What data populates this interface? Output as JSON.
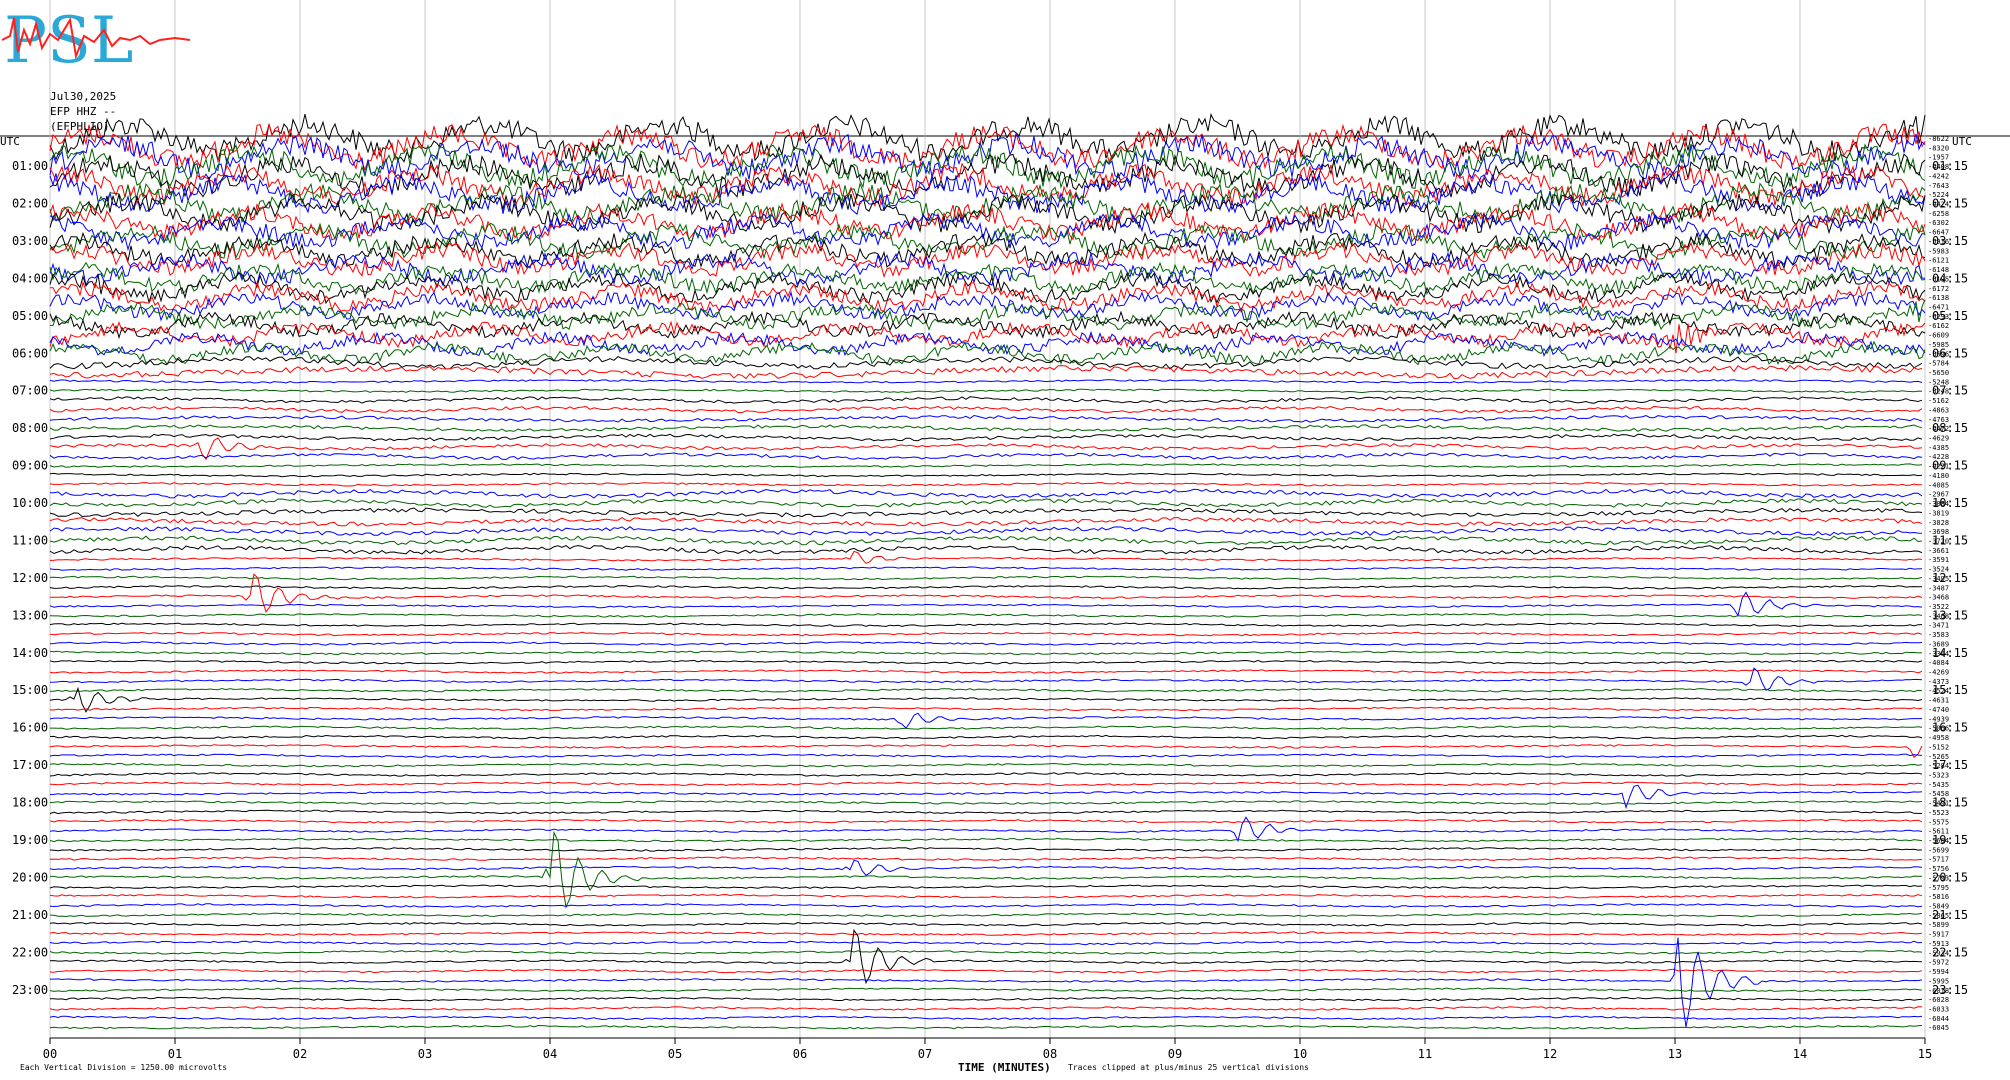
{
  "logo_text": "PSL",
  "header": {
    "date": "Jul30,2025",
    "channel": "EFP HHZ --",
    "network": "(EFPHLIO)"
  },
  "utc_label_left": "UTC",
  "utc_label_right": "UTC",
  "chart_data": {
    "type": "line",
    "title": "",
    "xlabel": "TIME (MINUTES)",
    "x_ticks": [
      "00",
      "01",
      "02",
      "03",
      "04",
      "05",
      "06",
      "07",
      "08",
      "09",
      "10",
      "11",
      "12",
      "13",
      "14",
      "15"
    ],
    "xlim": [
      0,
      15
    ],
    "left_hour_labels": [
      "01:00",
      "02:00",
      "03:00",
      "04:00",
      "05:00",
      "06:00",
      "07:00",
      "08:00",
      "09:00",
      "10:00",
      "11:00",
      "12:00",
      "13:00",
      "14:00",
      "15:00",
      "16:00",
      "17:00",
      "18:00",
      "19:00",
      "20:00",
      "21:00",
      "22:00",
      "23:00"
    ],
    "right_hour_labels": [
      "01:15",
      "02:15",
      "03:15",
      "04:15",
      "05:15",
      "06:15",
      "07:15",
      "08:15",
      "09:15",
      "10:15",
      "11:15",
      "12:15",
      "13:15",
      "14:15",
      "15:15",
      "16:15",
      "17:15",
      "18:15",
      "19:15",
      "20:15",
      "21:15",
      "22:15",
      "23:15"
    ],
    "trace_offsets": [
      "-8622",
      "-8320",
      "-1957",
      "-4408",
      "-4242",
      "-7643",
      "-5224",
      "-4424",
      "-6258",
      "-6302",
      "-6647",
      "-5916",
      "-5983",
      "-6121",
      "-6148",
      "-6195",
      "-6172",
      "-6138",
      "-6471",
      "-6293",
      "-6162",
      "-6609",
      "-5985",
      "-5696",
      "-5784",
      "-5650",
      "-5248",
      "-5248",
      "-5162",
      "-4863",
      "-4763",
      "-4472",
      "-4629",
      "-4385",
      "-4228",
      "-4221",
      "-4180",
      "-4085",
      "-2967",
      "-3884",
      "-3819",
      "-3828",
      "-3698",
      "-3720",
      "-3661",
      "-3591",
      "-3524",
      "-3495",
      "-3487",
      "-3468",
      "-3522",
      "-3468",
      "-3471",
      "-3583",
      "-3689",
      "-3364",
      "-4084",
      "-4269",
      "-4373",
      "-4524",
      "-4631",
      "-4740",
      "-4939",
      "-5066",
      "-4958",
      "-5152",
      "-5265",
      "-5284",
      "-5323",
      "-5435",
      "-5458",
      "-5491",
      "-5523",
      "-5575",
      "-5611",
      "-5664",
      "-5699",
      "-5717",
      "-5756",
      "-5793",
      "-5795",
      "-5816",
      "-5849",
      "-5865",
      "-5899",
      "-5917",
      "-5913",
      "-5934",
      "-5972",
      "-5994",
      "-5995",
      "-6018",
      "-6028",
      "-6033",
      "-6044",
      "-6045"
    ],
    "colors": [
      "#000000",
      "#ff0000",
      "#0000ff",
      "#006400"
    ],
    "num_traces": 96,
    "minutes_per_line": 15,
    "events": [
      {
        "line": 0,
        "minute": 14.9,
        "amp": 2.5
      },
      {
        "line": 16,
        "minute": 0.2,
        "amp": 2
      },
      {
        "line": 19,
        "minute": 14.9,
        "amp": 2
      },
      {
        "line": 21,
        "minute": 13.0,
        "amp": 2.5
      },
      {
        "line": 33,
        "minute": 1.2,
        "amp": 2.5
      },
      {
        "line": 45,
        "minute": 6.4,
        "amp": 1.5
      },
      {
        "line": 49,
        "minute": 1.6,
        "amp": 5
      },
      {
        "line": 50,
        "minute": 13.5,
        "amp": 3
      },
      {
        "line": 58,
        "minute": 13.6,
        "amp": 3
      },
      {
        "line": 60,
        "minute": 0.2,
        "amp": 3
      },
      {
        "line": 62,
        "minute": 6.8,
        "amp": 2
      },
      {
        "line": 65,
        "minute": 14.9,
        "amp": 2
      },
      {
        "line": 70,
        "minute": 12.6,
        "amp": 2.5
      },
      {
        "line": 74,
        "minute": 9.5,
        "amp": 3
      },
      {
        "line": 78,
        "minute": 6.4,
        "amp": 2
      },
      {
        "line": 79,
        "minute": 4.0,
        "amp": 10
      },
      {
        "line": 88,
        "minute": 6.4,
        "amp": 7
      },
      {
        "line": 90,
        "minute": 13.0,
        "amp": 12
      }
    ],
    "footer_left": "Each Vertical Division = 1250.00 microvolts",
    "footer_clip": "Traces clipped at plus/minus 25 vertical divisions"
  }
}
